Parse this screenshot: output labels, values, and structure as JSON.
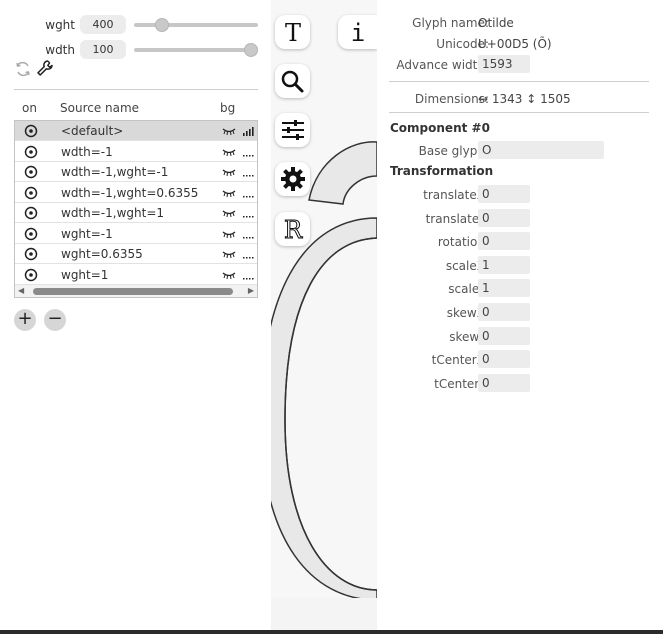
{
  "axes": [
    {
      "name": "wght",
      "value": "400",
      "fraction": 0.22
    },
    {
      "name": "wdth",
      "value": "100",
      "fraction": 1.0
    }
  ],
  "sources": {
    "columns": {
      "on": "on",
      "name": "Source name",
      "bg": "bg"
    },
    "rows": [
      {
        "name": "<default>",
        "selected": true,
        "bg_icon": "bars-icon"
      },
      {
        "name": "wdth=-1",
        "selected": false,
        "bg_icon": "dots-icon"
      },
      {
        "name": "wdth=-1,wght=-1",
        "selected": false,
        "bg_icon": "dots-icon"
      },
      {
        "name": "wdth=-1,wght=0.6355",
        "selected": false,
        "bg_icon": "dots-icon"
      },
      {
        "name": "wdth=-1,wght=1",
        "selected": false,
        "bg_icon": "dots-icon"
      },
      {
        "name": "wght=-1",
        "selected": false,
        "bg_icon": "dots-icon"
      },
      {
        "name": "wght=0.6355",
        "selected": false,
        "bg_icon": "dots-icon"
      },
      {
        "name": "wght=1",
        "selected": false,
        "bg_icon": "dots-icon"
      }
    ],
    "add_label": "+",
    "remove_label": "−"
  },
  "side_toolbar": {
    "text_tool": "T",
    "info_tool": "i",
    "reference_tool": "R"
  },
  "glyph_info": {
    "glyph_name_label": "Glyph name:",
    "glyph_name": "Otilde",
    "unicode_label": "Unicode:",
    "unicode": "U+00D5 (Õ)",
    "advance_width_label": "Advance width:",
    "advance_width": "1593",
    "dimensions_label": "Dimensions:",
    "dimensions": "↔ 1343 ↕ 1505"
  },
  "component": {
    "title": "Component #0",
    "base_glyph_label": "Base glyph:",
    "base_glyph": "O",
    "transformation_title": "Transformation",
    "fields": [
      {
        "label": "translateX:",
        "value": "0"
      },
      {
        "label": "translateY:",
        "value": "0"
      },
      {
        "label": "rotation:",
        "value": "0"
      },
      {
        "label": "scaleX:",
        "value": "1"
      },
      {
        "label": "scaleY:",
        "value": "1"
      },
      {
        "label": "skewX:",
        "value": "0"
      },
      {
        "label": "skewY:",
        "value": "0"
      },
      {
        "label": "tCenterX:",
        "value": "0"
      },
      {
        "label": "tCenterY:",
        "value": "0"
      }
    ]
  },
  "colors": {
    "selected_row": "#d9d9d9",
    "field_bg": "#ececec",
    "glyph_fill": "#e8e8e8",
    "glyph_stroke": "#333333"
  }
}
